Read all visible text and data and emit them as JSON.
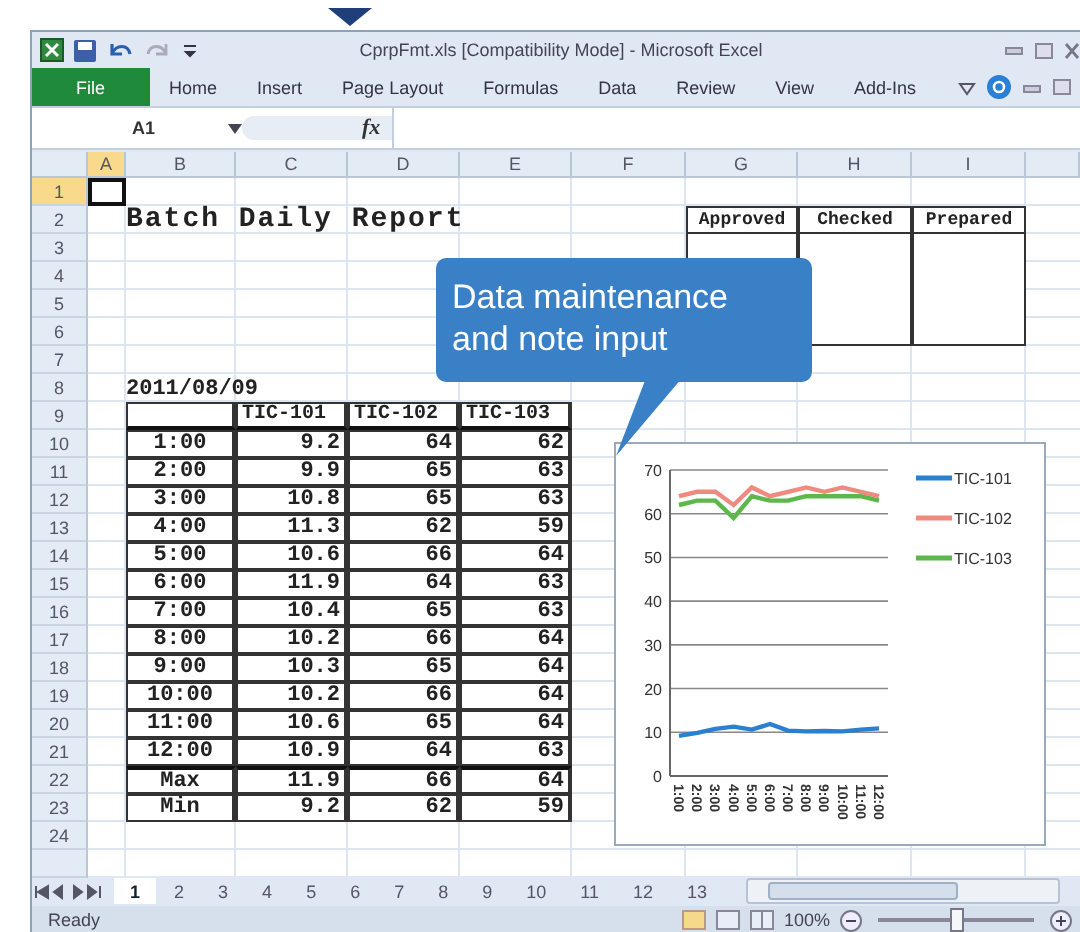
{
  "window": {
    "title": "CprpFmt.xls  [Compatibility Mode]  -  Microsoft Excel"
  },
  "ribbon_tabs": [
    {
      "label": "File",
      "selected": true
    },
    {
      "label": "Home",
      "selected": false
    },
    {
      "label": "Insert",
      "selected": false
    },
    {
      "label": "Page Layout",
      "selected": false
    },
    {
      "label": "Formulas",
      "selected": false
    },
    {
      "label": "Data",
      "selected": false
    },
    {
      "label": "Review",
      "selected": false
    },
    {
      "label": "View",
      "selected": false
    },
    {
      "label": "Add-Ins",
      "selected": false
    }
  ],
  "formula_bar": {
    "name_box": "A1",
    "function_label": "fx"
  },
  "columns": [
    {
      "label": "A",
      "selected": true
    },
    {
      "label": "B",
      "selected": false
    },
    {
      "label": "C",
      "selected": false
    },
    {
      "label": "D",
      "selected": false
    },
    {
      "label": "E",
      "selected": false
    },
    {
      "label": "F",
      "selected": false
    },
    {
      "label": "G",
      "selected": false
    },
    {
      "label": "H",
      "selected": false
    },
    {
      "label": "I",
      "selected": false
    }
  ],
  "rows": [
    {
      "label": "1",
      "selected": true
    },
    {
      "label": "2",
      "selected": false
    },
    {
      "label": "3",
      "selected": false
    },
    {
      "label": "4",
      "selected": false
    },
    {
      "label": "5",
      "selected": false
    },
    {
      "label": "6",
      "selected": false
    },
    {
      "label": "7",
      "selected": false
    },
    {
      "label": "8",
      "selected": false
    },
    {
      "label": "9",
      "selected": false
    },
    {
      "label": "10",
      "selected": false
    },
    {
      "label": "11",
      "selected": false
    },
    {
      "label": "12",
      "selected": false
    },
    {
      "label": "13",
      "selected": false
    },
    {
      "label": "14",
      "selected": false
    },
    {
      "label": "15",
      "selected": false
    },
    {
      "label": "16",
      "selected": false
    },
    {
      "label": "17",
      "selected": false
    },
    {
      "label": "18",
      "selected": false
    },
    {
      "label": "19",
      "selected": false
    },
    {
      "label": "20",
      "selected": false
    },
    {
      "label": "21",
      "selected": false
    },
    {
      "label": "22",
      "selected": false
    },
    {
      "label": "23",
      "selected": false
    },
    {
      "label": "24",
      "selected": false
    }
  ],
  "sheet": {
    "title": "Batch Daily Report",
    "date": "2011/08/09",
    "approvals": [
      "Approved",
      "Checked",
      "Prepared"
    ],
    "table": {
      "columns": [
        "TIC-101",
        "TIC-102",
        "TIC-103"
      ],
      "rows": [
        {
          "label": "1:00",
          "kind": "hour",
          "cells": [
            "9.2",
            "64",
            "62"
          ]
        },
        {
          "label": "2:00",
          "kind": "hour",
          "cells": [
            "9.9",
            "65",
            "63"
          ]
        },
        {
          "label": "3:00",
          "kind": "hour",
          "cells": [
            "10.8",
            "65",
            "63"
          ]
        },
        {
          "label": "4:00",
          "kind": "hour",
          "cells": [
            "11.3",
            "62",
            "59"
          ]
        },
        {
          "label": "5:00",
          "kind": "hour",
          "cells": [
            "10.6",
            "66",
            "64"
          ]
        },
        {
          "label": "6:00",
          "kind": "hour",
          "cells": [
            "11.9",
            "64",
            "63"
          ]
        },
        {
          "label": "7:00",
          "kind": "hour",
          "cells": [
            "10.4",
            "65",
            "63"
          ]
        },
        {
          "label": "8:00",
          "kind": "hour",
          "cells": [
            "10.2",
            "66",
            "64"
          ]
        },
        {
          "label": "9:00",
          "kind": "hour",
          "cells": [
            "10.3",
            "65",
            "64"
          ]
        },
        {
          "label": "10:00",
          "kind": "hour",
          "cells": [
            "10.2",
            "66",
            "64"
          ]
        },
        {
          "label": "11:00",
          "kind": "hour",
          "cells": [
            "10.6",
            "65",
            "64"
          ]
        },
        {
          "label": "12:00",
          "kind": "hour",
          "cells": [
            "10.9",
            "64",
            "63"
          ]
        },
        {
          "label": "Max",
          "kind": "summary",
          "cells": [
            "11.9",
            "66",
            "64"
          ]
        },
        {
          "label": "Min",
          "kind": "summary",
          "cells": [
            "9.2",
            "62",
            "59"
          ]
        }
      ]
    }
  },
  "chart": {
    "chart_data": {
      "type": "line",
      "categories": [
        "1:00",
        "2:00",
        "3:00",
        "4:00",
        "5:00",
        "6:00",
        "7:00",
        "8:00",
        "9:00",
        "10:00",
        "11:00",
        "12:00"
      ],
      "series": [
        {
          "name": "TIC-101",
          "color": "#2a80d0",
          "values": [
            9.2,
            9.9,
            10.8,
            11.3,
            10.6,
            11.9,
            10.4,
            10.2,
            10.3,
            10.2,
            10.6,
            10.9
          ]
        },
        {
          "name": "TIC-102",
          "color": "#f08a80",
          "values": [
            64,
            65,
            65,
            62,
            66,
            64,
            65,
            66,
            65,
            66,
            65,
            64
          ]
        },
        {
          "name": "TIC-103",
          "color": "#5cb84a",
          "values": [
            62,
            63,
            63,
            59,
            64,
            63,
            63,
            64,
            64,
            64,
            64,
            63
          ]
        }
      ],
      "ylim": [
        0,
        70
      ],
      "yticks": [
        0,
        10,
        20,
        30,
        40,
        50,
        60,
        70
      ],
      "grid": true,
      "legend": true
    }
  },
  "callout": {
    "text": "Data maintenance and note input"
  },
  "sheet_tabs": [
    {
      "label": "1",
      "selected": true
    },
    {
      "label": "2",
      "selected": false
    },
    {
      "label": "3",
      "selected": false
    },
    {
      "label": "4",
      "selected": false
    },
    {
      "label": "5",
      "selected": false
    },
    {
      "label": "6",
      "selected": false
    },
    {
      "label": "7",
      "selected": false
    },
    {
      "label": "8",
      "selected": false
    },
    {
      "label": "9",
      "selected": false
    },
    {
      "label": "10",
      "selected": false
    },
    {
      "label": "11",
      "selected": false
    },
    {
      "label": "12",
      "selected": false
    },
    {
      "label": "13",
      "selected": false
    }
  ],
  "status_bar": {
    "text": "Ready",
    "zoom": "100%",
    "zoom_slider": {
      "level": 0.5
    }
  }
}
